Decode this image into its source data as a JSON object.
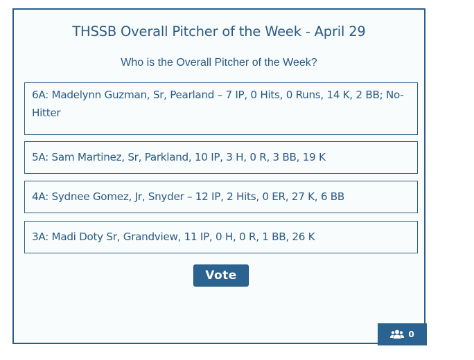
{
  "poll": {
    "title": "THSSB Overall Pitcher of the Week - April 29",
    "question": "Who is the Overall Pitcher of the Week?",
    "options": [
      {
        "label": "6A: Madelynn Guzman, Sr, Pearland – 7 IP, 0 Hits, 0 Runs, 14 K, 2 BB; No-Hitter"
      },
      {
        "label": "5A: Sam Martinez, Sr, Parkland, 10 IP, 3 H, 0 R, 3 BB, 19 K"
      },
      {
        "label": "4A: Sydnee Gomez, Jr, Snyder – 12 IP, 2 Hits, 0 ER, 27 K, 6 BB"
      },
      {
        "label": "3A: Madi Doty Sr, Grandview, 11 IP, 0 H, 0 R, 1 BB, 26 K"
      }
    ],
    "vote_label": "Vote",
    "results": {
      "icon": "users-icon",
      "count": "0"
    }
  },
  "colors": {
    "accent": "#2b5a84",
    "button": "#2b6390",
    "background": "#f8fcfc"
  }
}
